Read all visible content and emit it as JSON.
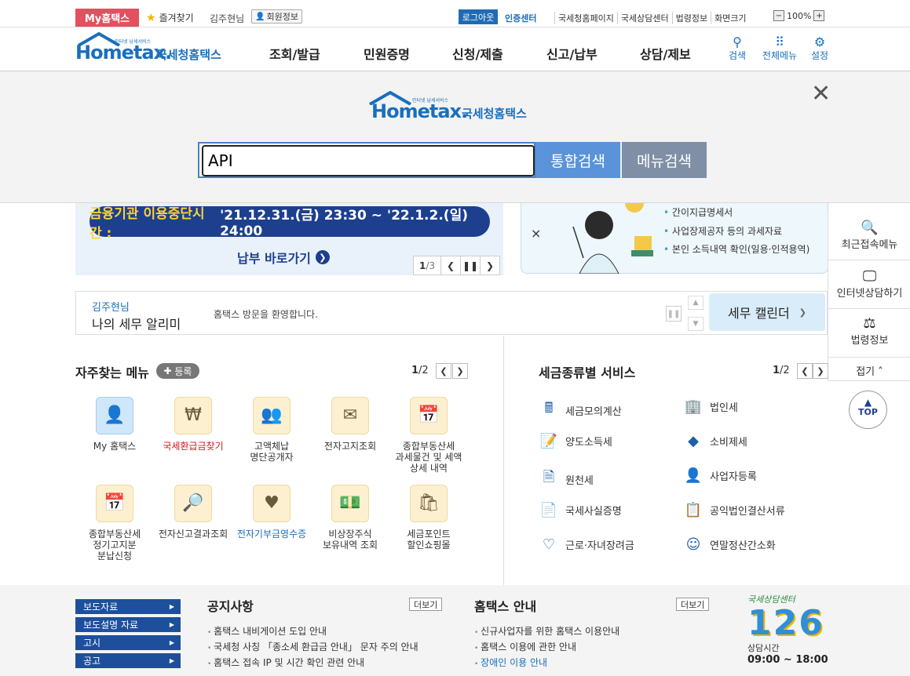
{
  "topbar": {
    "my_label": "My홈택스",
    "fav_label": "즐겨찾기",
    "user_name": "김주현님",
    "member_label": "회원정보",
    "logout_label": "로그아웃",
    "cert_label": "인증센터",
    "links": [
      "국세청홈페이지",
      "국세상담센터",
      "법령정보",
      "화면크기"
    ],
    "zoom": "100%"
  },
  "header": {
    "logo_text": "Hometax.",
    "logo_kr": "국세청홈택스",
    "logo_sub": "인터넷 납세서비스",
    "nav": [
      "조회/발급",
      "민원증명",
      "신청/제출",
      "신고/납부",
      "상담/제보"
    ],
    "tools": [
      {
        "icon": "search-icon",
        "label": "검색"
      },
      {
        "icon": "grid-icon",
        "label": "전체메뉴"
      },
      {
        "icon": "gear-icon",
        "label": "설정"
      }
    ]
  },
  "search": {
    "value": "API",
    "total_label": "통합검색",
    "menu_label": "메뉴검색"
  },
  "banner": {
    "notice_label": "금융기관 이용중단시간 :",
    "notice_time": "'21.12.31.(금) 23:30 ~ '22.1.2.(일) 24:00",
    "link_label": "납부 바로가기",
    "page": "1",
    "total": "/3",
    "right_items": [
      "간이지급명세서",
      "사업장제공자 등의 과세자료",
      "본인 소득내역 확인(일용·인적용역)"
    ]
  },
  "quick": {
    "items": [
      "최근접속메뉴",
      "인터넷상담하기",
      "법령정보"
    ],
    "fold_label": "접기",
    "top_label": "TOP"
  },
  "alarm": {
    "name": "김주현님",
    "title": "나의 세무 알리미",
    "message": "홈택스 방문을 환영합니다.",
    "calendar_label": "세무 캘린더"
  },
  "frequent": {
    "title": "자주찾는 메뉴",
    "register_label": "등록",
    "page": "1",
    "total": "/2",
    "items": [
      "My 홈택스",
      "국세환급금찾기",
      "고액체납\n명단공개자",
      "전자고지조회",
      "종합부동산세\n과세물건 및 세액\n상세 내역",
      "종합부동산세\n정기고지분\n분납신청",
      "전자신고결과조회",
      "전자기부금영수증",
      "비상장주식\n보유내역 조회",
      "세금포인트\n할인쇼핑몰"
    ]
  },
  "taxservice": {
    "title": "세금종류별 서비스",
    "page": "1",
    "total": "/2",
    "items": [
      "세금모의계산",
      "법인세",
      "양도소득세",
      "소비제세",
      "원천세",
      "사업자등록",
      "국세사실증명",
      "공익법인결산서류",
      "근로·자녀장려금",
      "연말정산간소화"
    ]
  },
  "footer": {
    "nav": [
      "보도자료",
      "보도설명 자료",
      "고시",
      "공고"
    ],
    "notice_title": "공지사항",
    "notice_items": [
      "홈택스 내비게이션 도입 안내",
      "국세청 사칭 「종소세 환급금 안내」 문자 주의 안내",
      "홈택스 접속 IP 및 시간 확인 관련 안내"
    ],
    "guide_title": "홈택스 안내",
    "guide_items": [
      "신규사업자를 위한 홈택스 이용안내",
      "홈택스 이용에 관한 안내",
      "장애인 이용 안내"
    ],
    "more_label": "더보기",
    "center_title": "국세상담센터",
    "center_number": "126",
    "center_hours_label": "상담시간",
    "center_hours": "09:00 ~ 18:00"
  }
}
